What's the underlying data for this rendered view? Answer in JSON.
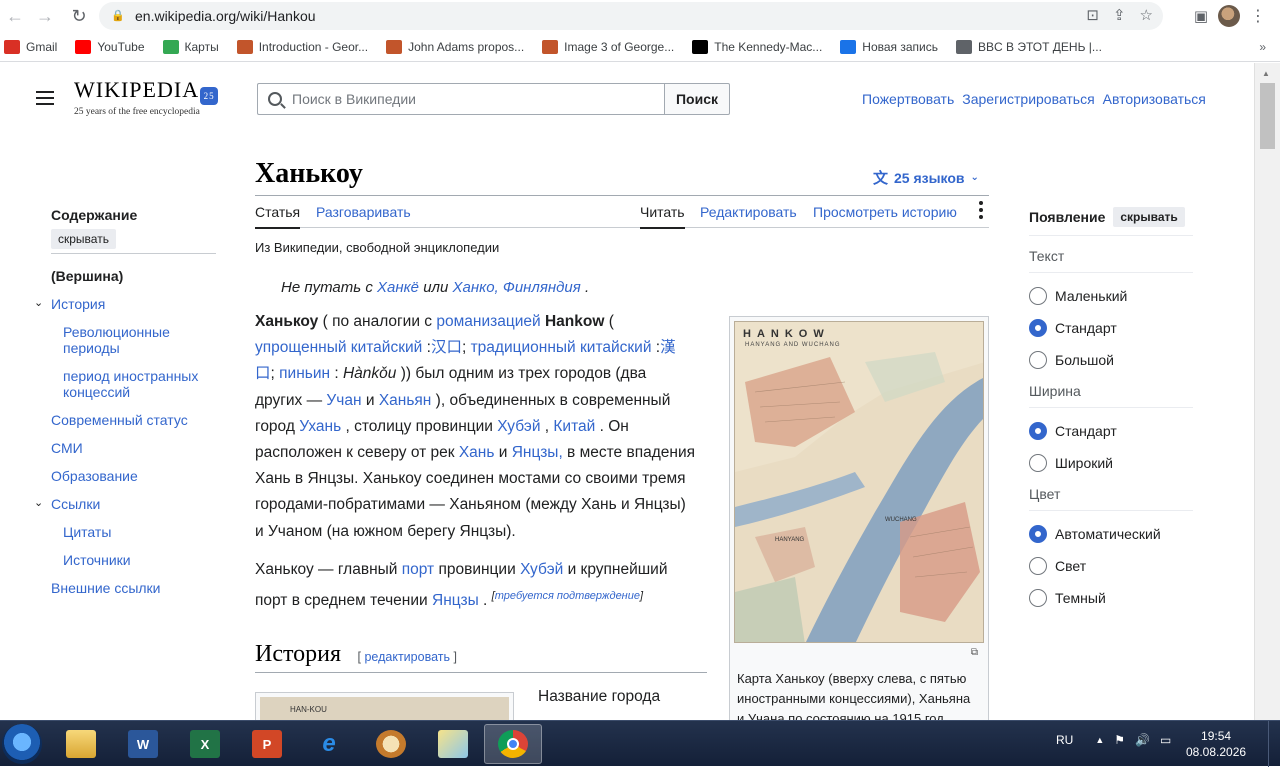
{
  "browser": {
    "url": "en.wikipedia.org/wiki/Hankou",
    "bookmarks": [
      {
        "label": "Gmail",
        "icon": "gmail-icon",
        "color": "#d93025"
      },
      {
        "label": "YouTube",
        "icon": "youtube-icon",
        "color": "#ff0000"
      },
      {
        "label": "Карты",
        "icon": "maps-icon",
        "color": "#34a853"
      },
      {
        "label": "Introduction - Geor...",
        "icon": "loc-icon",
        "color": "#c2552b"
      },
      {
        "label": "John Adams propos...",
        "icon": "loc-icon",
        "color": "#c2552b"
      },
      {
        "label": "Image 3 of George...",
        "icon": "loc-icon",
        "color": "#c2552b"
      },
      {
        "label": "The Kennedy-Mac...",
        "icon": "nyt-icon",
        "color": "#000000"
      },
      {
        "label": "Новая запись",
        "icon": "feather-icon",
        "color": "#1a73e8"
      },
      {
        "label": "BBC В ЭТОТ ДЕНЬ |...",
        "icon": "globe-icon",
        "color": "#5f6368"
      }
    ],
    "bookmarks_more": "»"
  },
  "wiki": {
    "logo_word": "WIKIPEDIA",
    "logo_tag": "25 years of the free encyclopedia",
    "logo_badge": "25",
    "search_placeholder": "Поиск в Википедии",
    "search_button": "Поиск",
    "user_links": [
      "Пожертвовать",
      "Зарегистрироваться",
      "Авторизоваться"
    ]
  },
  "toc": {
    "heading": "Содержание",
    "hide": "скрывать",
    "items": [
      {
        "label": "(Вершина)",
        "level": 0
      },
      {
        "label": "История",
        "level": 0,
        "caret": true
      },
      {
        "label": "Революционные периоды",
        "level": 1
      },
      {
        "label": "период иностранных концессий",
        "level": 1
      },
      {
        "label": "Современный статус",
        "level": 0
      },
      {
        "label": "СМИ",
        "level": 0
      },
      {
        "label": "Образование",
        "level": 0
      },
      {
        "label": "Ссылки",
        "level": 0,
        "caret": true
      },
      {
        "label": "Цитаты",
        "level": 1
      },
      {
        "label": "Источники",
        "level": 1
      },
      {
        "label": "Внешние ссылки",
        "level": 0
      }
    ]
  },
  "article": {
    "title": "Ханькоу",
    "languages": "25 языков",
    "tabs": {
      "article": "Статья",
      "talk": "Разговаривать",
      "read": "Читать",
      "edit": "Редактировать",
      "history": "Просмотреть историю"
    },
    "from": "Из Википедии, свободной энциклопедии",
    "hatnote": {
      "pre": "Не путать с",
      "link1": "Ханкё",
      "mid": "или",
      "link2": "Ханко, Финляндия",
      "post": "."
    },
    "p1": {
      "b1": "Ханькоу",
      "t1": " ( по аналогии с ",
      "l1": "романизацией",
      "b2": " Hankow",
      "t2": " ( ",
      "l2": "упрощенный китайский",
      "t3": " :",
      "l3": "汉口",
      "t4": "; ",
      "l4": "традиционный китайский",
      "t5": " :",
      "l5": "漢口",
      "t6": "; ",
      "l6": "пиньин",
      "t7": " : ",
      "i1": "Hànkǒu",
      "t8": " )) был одним из трех городов (два других — ",
      "l7": "Учан",
      "t9": " и ",
      "l8": "Ханьян",
      "t10": " ), объединенных в современный город ",
      "l9": "Ухань",
      "t11": " , столицу провинции ",
      "l10": "Хубэй",
      "t12": " , ",
      "l11": "Китай",
      "t13": " . Он расположен к северу от рек ",
      "l12": "Хань",
      "t14": " и ",
      "l13": "Янцзы,",
      "t15": " в месте впадения Хань в Янцзы. Ханькоу соединен мостами со своими тремя городами-побратимами — Ханьяном (между Хань и Янцзы) и Учаном (на южном берегу Янцзы)."
    },
    "p2": {
      "t1": "Ханькоу — главный ",
      "l1": "порт",
      "t2": " провинции ",
      "l2": "Хубэй",
      "t3": " и крупнейший порт в среднем течении ",
      "l3": "Янцзы",
      "t4": " . ",
      "sup_open": "[",
      "sup": "требуется подтверждение",
      "sup_close": "]"
    },
    "map": {
      "title": "HANKOW",
      "subtitle": "HANYANG AND WUCHANG",
      "label_hanyang": "HANYANG",
      "label_wuchang": "WUCHANG",
      "caption": "Карта Ханькоу (вверху слева, с пятью иностранными концессиями), Ханьяна и Учана по состоянию на 1915 год."
    },
    "history_heading": "История",
    "history_edit": "редактировать",
    "history_edit_open": "[",
    "history_edit_close": "]",
    "history_img_label": "HAN-KOU",
    "history_text": "Название города"
  },
  "appearance": {
    "heading": "Появление",
    "hide": "скрывать",
    "text_label": "Текст",
    "text_options": [
      {
        "label": "Маленький",
        "selected": false
      },
      {
        "label": "Стандарт",
        "selected": true
      },
      {
        "label": "Большой",
        "selected": false
      }
    ],
    "width_label": "Ширина",
    "width_options": [
      {
        "label": "Стандарт",
        "selected": true
      },
      {
        "label": "Широкий",
        "selected": false
      }
    ],
    "color_label": "Цвет",
    "color_options": [
      {
        "label": "Автоматический",
        "selected": true
      },
      {
        "label": "Свет",
        "selected": false
      },
      {
        "label": "Темный",
        "selected": false
      }
    ]
  },
  "taskbar": {
    "lang": "RU",
    "time": "19:54",
    "date": "08.08.2026",
    "apps": [
      "explorer",
      "word",
      "excel",
      "powerpoint",
      "ie",
      "paint",
      "photos",
      "chrome"
    ]
  }
}
